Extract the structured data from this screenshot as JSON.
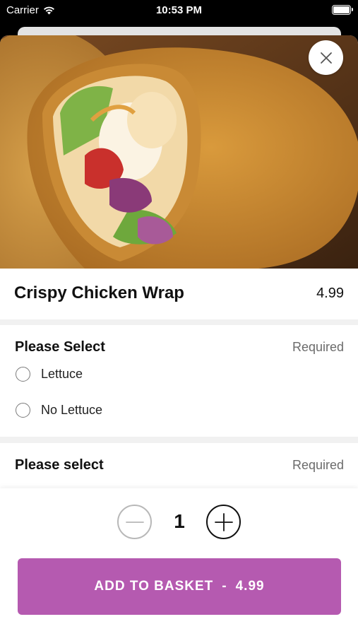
{
  "status_bar": {
    "carrier": "Carrier",
    "time": "10:53 PM"
  },
  "product": {
    "name": "Crispy Chicken Wrap",
    "price": "4.99"
  },
  "sections": [
    {
      "heading": "Please Select",
      "badge": "Required",
      "options": [
        {
          "label": "Lettuce",
          "selected": false
        },
        {
          "label": "No Lettuce",
          "selected": false
        }
      ]
    },
    {
      "heading": "Please select",
      "badge": "Required",
      "options": []
    }
  ],
  "quantity": {
    "value": "1"
  },
  "add_button": {
    "label": "ADD TO BASKET",
    "separator": "-",
    "price": "4.99"
  },
  "colors": {
    "accent": "#b55ab0"
  }
}
